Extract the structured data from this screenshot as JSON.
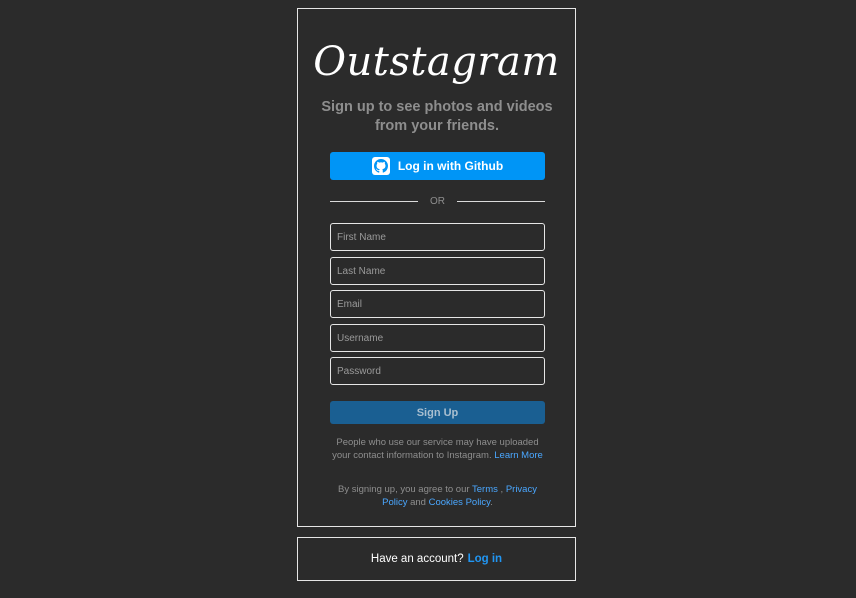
{
  "logo": "Outstagram",
  "tagline": "Sign up to see photos and videos from your friends.",
  "github_button": {
    "label": "Log in with Github",
    "icon": "github-icon"
  },
  "divider_text": "OR",
  "fields": {
    "first_name": {
      "placeholder": "First Name",
      "value": ""
    },
    "last_name": {
      "placeholder": "Last Name",
      "value": ""
    },
    "email": {
      "placeholder": "Email",
      "value": ""
    },
    "username": {
      "placeholder": "Username",
      "value": ""
    },
    "password": {
      "placeholder": "Password",
      "value": ""
    }
  },
  "signup_button": "Sign Up",
  "upload_notice": {
    "text": "People who use our service may have uploaded your contact information to Instagram.",
    "link": "Learn More"
  },
  "terms_notice": {
    "prefix": "By signing up, you agree to our",
    "terms": "Terms",
    "comma": ",",
    "privacy": "Privacy Policy",
    "and": "and",
    "cookies": "Cookies Policy",
    "suffix": "."
  },
  "login_prompt": {
    "text": "Have an account?",
    "link": "Log in"
  },
  "colors": {
    "background": "#2b2b2b",
    "primary": "#0095f6",
    "signup_button": "#1a5f92",
    "link": "#4aa7ff",
    "muted_text": "#8e8e8e"
  }
}
